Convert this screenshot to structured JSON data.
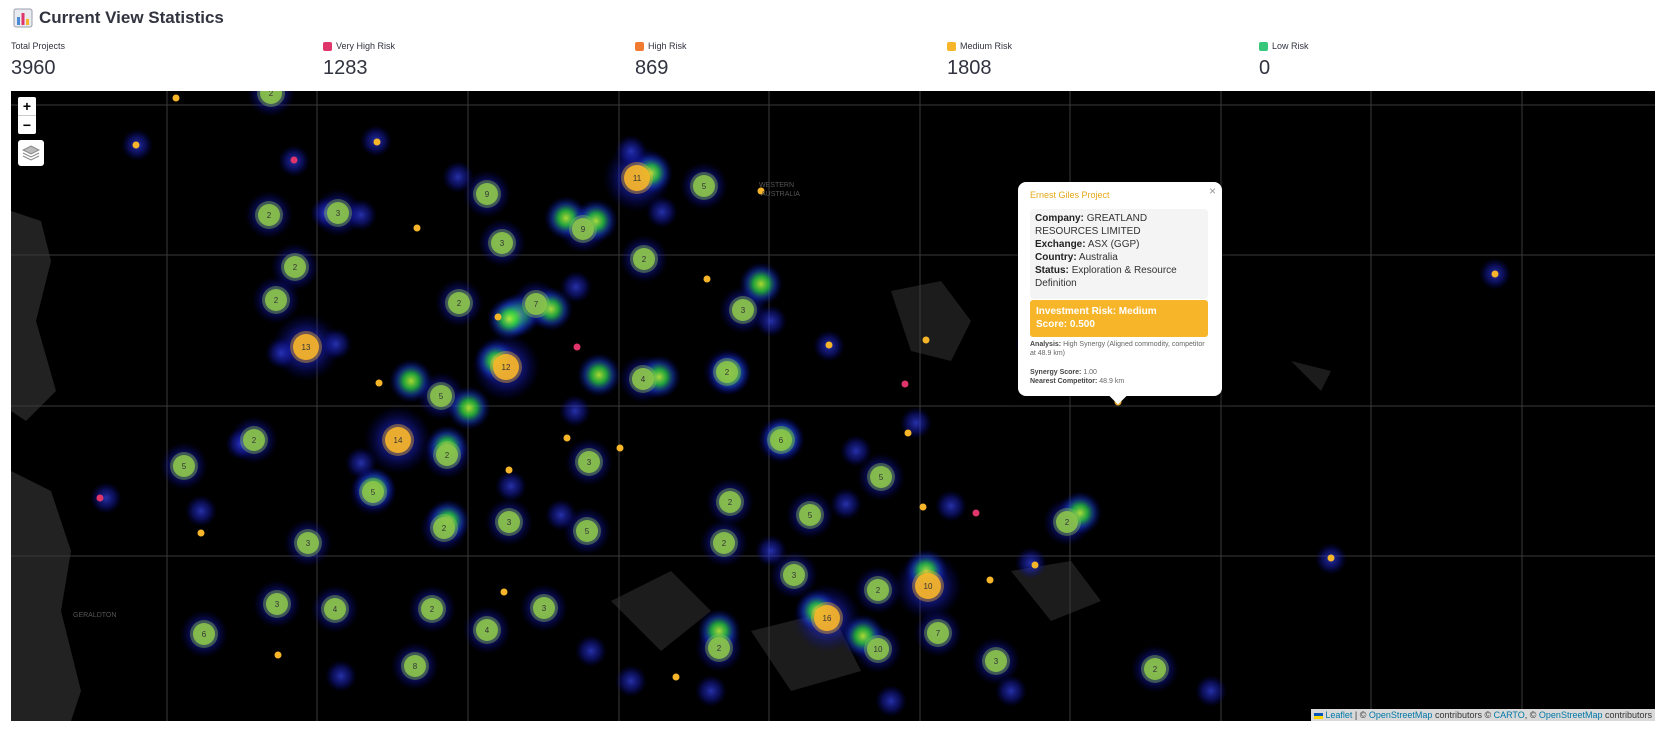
{
  "header": {
    "icon": "bar-chart-icon",
    "title": "Current View Statistics"
  },
  "stats": [
    {
      "label": "Total Projects",
      "value": "3960",
      "color": ""
    },
    {
      "label": "Very High Risk",
      "value": "1283",
      "color": "#e0356b"
    },
    {
      "label": "High Risk",
      "value": "869",
      "color": "#f07a2f"
    },
    {
      "label": "Medium Risk",
      "value": "1808",
      "color": "#f7b52a"
    },
    {
      "label": "Low Risk",
      "value": "0",
      "color": "#36c77a"
    }
  ],
  "map": {
    "zoom_in": "+",
    "zoom_out": "−",
    "place_labels": [
      "WESTERN",
      "AUSTRALIA",
      "GERALDTON"
    ],
    "clusters": [
      "2",
      "3",
      "2",
      "9",
      "3",
      "9",
      "11",
      "5",
      "2",
      "2",
      "2",
      "2",
      "7",
      "3",
      "13",
      "12",
      "5",
      "4",
      "2",
      "14",
      "2",
      "2",
      "5",
      "3",
      "5",
      "2",
      "3",
      "5",
      "3",
      "2",
      "6",
      "2",
      "5",
      "5",
      "2",
      "3",
      "2",
      "3",
      "4",
      "2",
      "3",
      "4",
      "6",
      "8",
      "16",
      "2",
      "10",
      "10",
      "7",
      "3",
      "2"
    ],
    "colors": {
      "cluster": "#8bc34a",
      "cluster_high": "#f7b52a",
      "point_medium": "#f7b52a",
      "point_very_high": "#e0356b"
    }
  },
  "popup": {
    "close": "×",
    "title": "Ernest Giles Project",
    "company_label": "Company:",
    "company": "GREATLAND RESOURCES LIMITED",
    "exchange_label": "Exchange:",
    "exchange": "ASX (GGP)",
    "country_label": "Country:",
    "country": "Australia",
    "status_label": "Status:",
    "status": "Exploration & Resource Definition",
    "risk_line1": "Investment Risk: Medium",
    "risk_line2": "Score: 0.500",
    "analysis_label": "Analysis:",
    "analysis": "High Synergy (Aligned commodity, competitor at 48.9 km)",
    "synergy_label": "Synergy Score:",
    "synergy": "1.00",
    "competitor_label": "Nearest Competitor:",
    "competitor": "48.9 km"
  },
  "attribution": {
    "leaflet": "Leaflet",
    "sep": " | © ",
    "osm1": "OpenStreetMap",
    "contrib1": " contributors © ",
    "carto": "CARTO",
    "sep2": ", © ",
    "osm2": "OpenStreetMap",
    "contrib2": " contributors"
  }
}
